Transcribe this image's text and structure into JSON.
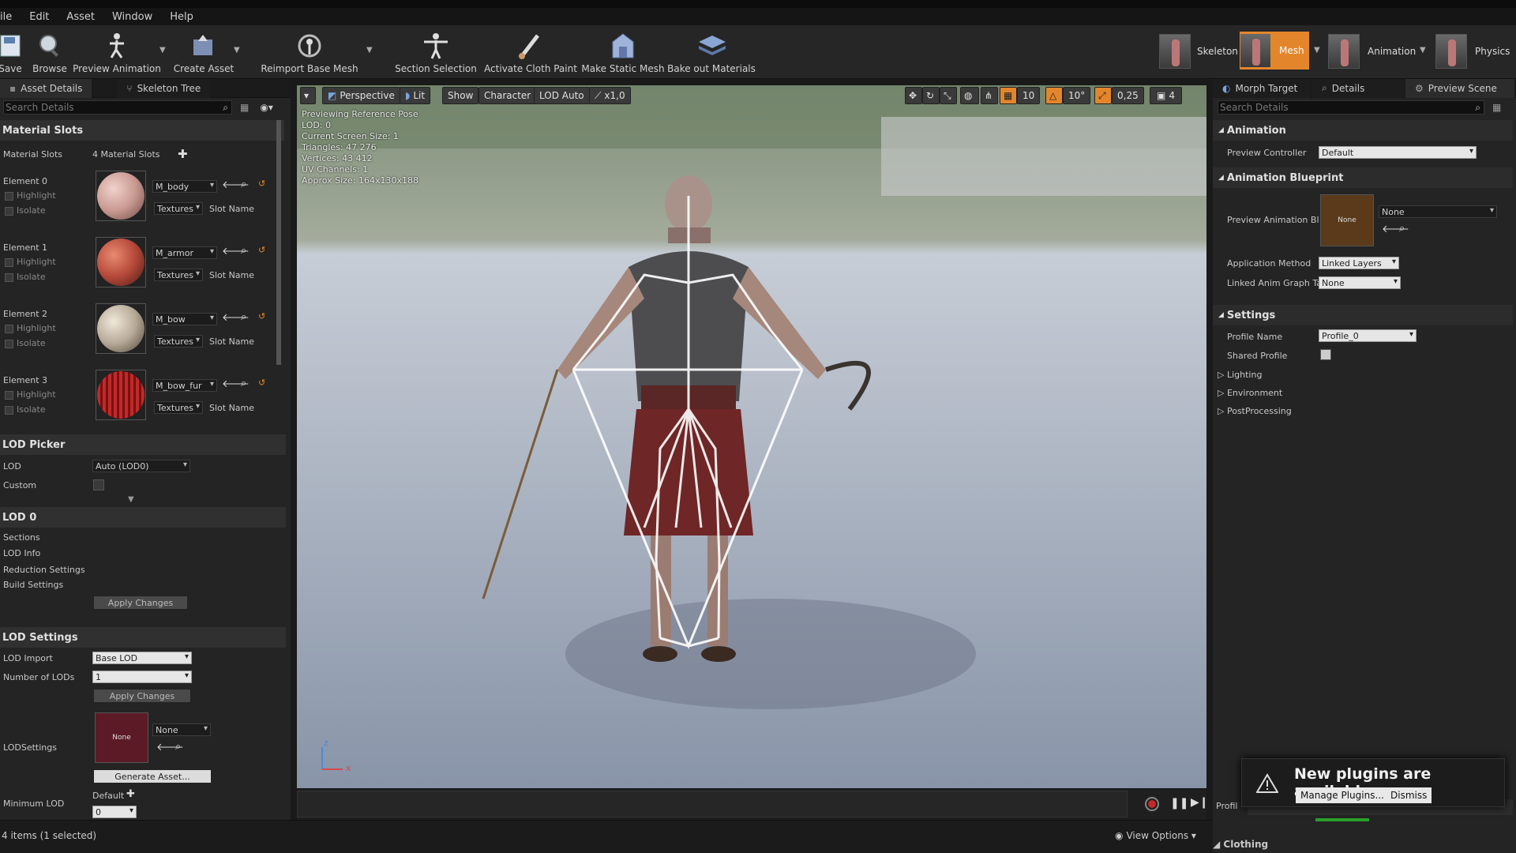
{
  "menu": [
    "ile",
    "Edit",
    "Asset",
    "Window",
    "Help"
  ],
  "toolbar": {
    "buttons": [
      "Save",
      "Browse",
      "Preview Animation",
      "Create Asset",
      "Reimport Base Mesh",
      "Section Selection",
      "Activate Cloth Paint",
      "Make Static Mesh",
      "Bake out Materials"
    ],
    "modes": [
      "Skeleton",
      "Mesh",
      "Animation",
      "Physics"
    ]
  },
  "left": {
    "tabs": [
      "Asset Details",
      "Skeleton Tree"
    ],
    "search_placeholder": "Search Details",
    "material_section": "Material Slots",
    "material_slots_label": "Material Slots",
    "material_slots_count": "4 Material Slots",
    "highlight": "Highlight",
    "isolate": "Isolate",
    "textures": "Textures",
    "slot_name": "Slot Name",
    "elements": [
      {
        "label": "Element 0",
        "material": "M_body",
        "color": "#c99a92"
      },
      {
        "label": "Element 1",
        "material": "M_armor",
        "color": "#b5493a"
      },
      {
        "label": "Element 2",
        "material": "M_bow",
        "color": "#b7aa98"
      },
      {
        "label": "Element 3",
        "material": "M_bow_fur",
        "color": "#a21e1e"
      }
    ],
    "lod_picker": {
      "title": "LOD Picker",
      "lod_label": "LOD",
      "lod_value": "Auto (LOD0)",
      "custom_label": "Custom"
    },
    "lod0": {
      "title": "LOD 0",
      "items": [
        "Sections",
        "LOD Info",
        "Reduction Settings",
        "Build Settings"
      ],
      "apply": "Apply Changes"
    },
    "lod_settings": {
      "title": "LOD Settings",
      "import_label": "LOD Import",
      "import_value": "Base LOD",
      "num_label": "Number of LODs",
      "num_value": "1",
      "apply": "Apply Changes",
      "lodsettings_label": "LODSettings",
      "none_thumb": "None",
      "none_value": "None",
      "generate": "Generate Asset...",
      "min_lod_label": "Minimum LOD",
      "min_lod_default": "Default",
      "min_lod_value": "0"
    }
  },
  "viewport": {
    "toolbar": [
      "Perspective",
      "Lit",
      "Show",
      "Character",
      "LOD Auto",
      "x1,0"
    ],
    "right_values": [
      "10",
      "10°",
      "0,25",
      "4"
    ],
    "info": [
      "Previewing Reference Pose",
      "LOD: 0",
      "Current Screen Size: 1",
      "Triangles: 47 276",
      "Vertices: 43 412",
      "UV Channels: 1",
      "Approx Size: 164x130x188"
    ],
    "axis_z": "z",
    "axis_x": "x",
    "bg_color": "#8b97aa"
  },
  "status": {
    "items": "4 items (1 selected)",
    "view_options": "View Options"
  },
  "right": {
    "tabs": [
      "Morph Target",
      "Details",
      "Preview Scene"
    ],
    "search_placeholder": "Search Details",
    "animation_section": "Animation",
    "preview_controller_label": "Preview Controller",
    "preview_controller_value": "Default",
    "blueprint_section": "Animation Blueprint",
    "preview_anim_label": "Preview Animation Bl",
    "none_thumb": "None",
    "none_value": "None",
    "app_method_label": "Application Method",
    "app_method_value": "Linked Layers",
    "linked_graph_label": "Linked Anim Graph Ta",
    "linked_graph_value": "None",
    "settings_section": "Settings",
    "profile_name_label": "Profile Name",
    "profile_name_value": "Profile_0",
    "shared_profile_label": "Shared Profile",
    "collapsed": [
      "Lighting",
      "Environment",
      "PostProcessing"
    ],
    "profile_short": "Profil",
    "clothing": "Clothing"
  },
  "notification": {
    "title": "New plugins are available",
    "manage": "Manage Plugins...",
    "dismiss": "Dismiss"
  },
  "accent": "#e3862b"
}
